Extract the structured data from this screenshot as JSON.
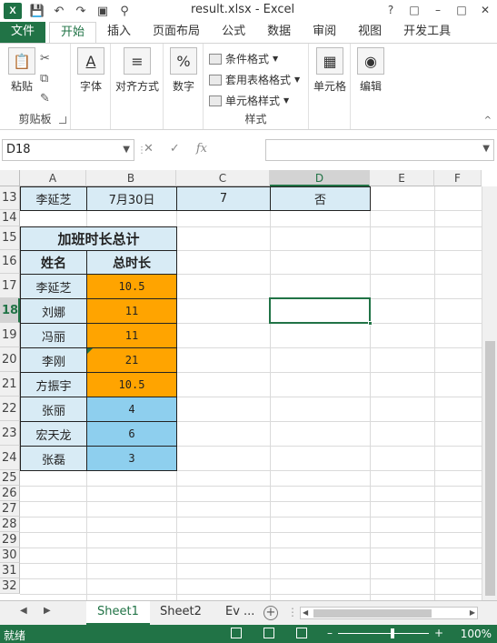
{
  "window": {
    "title": "result.xlsx - Excel",
    "app_icon_label": "X"
  },
  "ribbon_tabs": [
    "文件",
    "开始",
    "插入",
    "页面布局",
    "公式",
    "数据",
    "审阅",
    "视图",
    "开发工具"
  ],
  "ribbon": {
    "paste": "粘贴",
    "clipboard": "剪贴板",
    "font": "字体",
    "align": "对齐方式",
    "number": "数字",
    "cond_format": "条件格式",
    "table_format": "套用表格格式",
    "cell_style": "单元格样式",
    "styles": "样式",
    "cells": "单元格",
    "editing": "编辑"
  },
  "formula_bar": {
    "name_box": "D18",
    "fx": "fx",
    "value": ""
  },
  "columns": [
    "A",
    "B",
    "C",
    "D",
    "E",
    "F"
  ],
  "selected_column": "D",
  "rows": [
    "13",
    "14",
    "15",
    "16",
    "17",
    "18",
    "19",
    "20",
    "21",
    "22",
    "23",
    "24",
    "25",
    "26",
    "27",
    "28",
    "29",
    "30",
    "31",
    "32"
  ],
  "selected_row": "18",
  "row13": {
    "a": "李延芝",
    "b": "7月30日",
    "c": "7",
    "d": "否"
  },
  "summary_table": {
    "title": "加班时长总计",
    "col_name": "姓名",
    "col_hours": "总时长",
    "rows": [
      {
        "name": "李延芝",
        "hours": "10.5",
        "color": "#ffa400"
      },
      {
        "name": "刘娜",
        "hours": "11",
        "color": "#ffa400"
      },
      {
        "name": "冯丽",
        "hours": "11",
        "color": "#ffa400"
      },
      {
        "name": "李刚",
        "hours": "21",
        "color": "#ffa400"
      },
      {
        "name": "方振宇",
        "hours": "10.5",
        "color": "#ffa400"
      },
      {
        "name": "张丽",
        "hours": "4",
        "color": "#8ecfee"
      },
      {
        "name": "宏天龙",
        "hours": "6",
        "color": "#8ecfee"
      },
      {
        "name": "张磊",
        "hours": "3",
        "color": "#8ecfee"
      }
    ]
  },
  "sheet_tabs": [
    "Sheet1",
    "Sheet2",
    "Ev ..."
  ],
  "active_sheet": "Sheet1",
  "status": {
    "ready": "就绪",
    "zoom": "100%"
  },
  "accent_color": "#217346"
}
